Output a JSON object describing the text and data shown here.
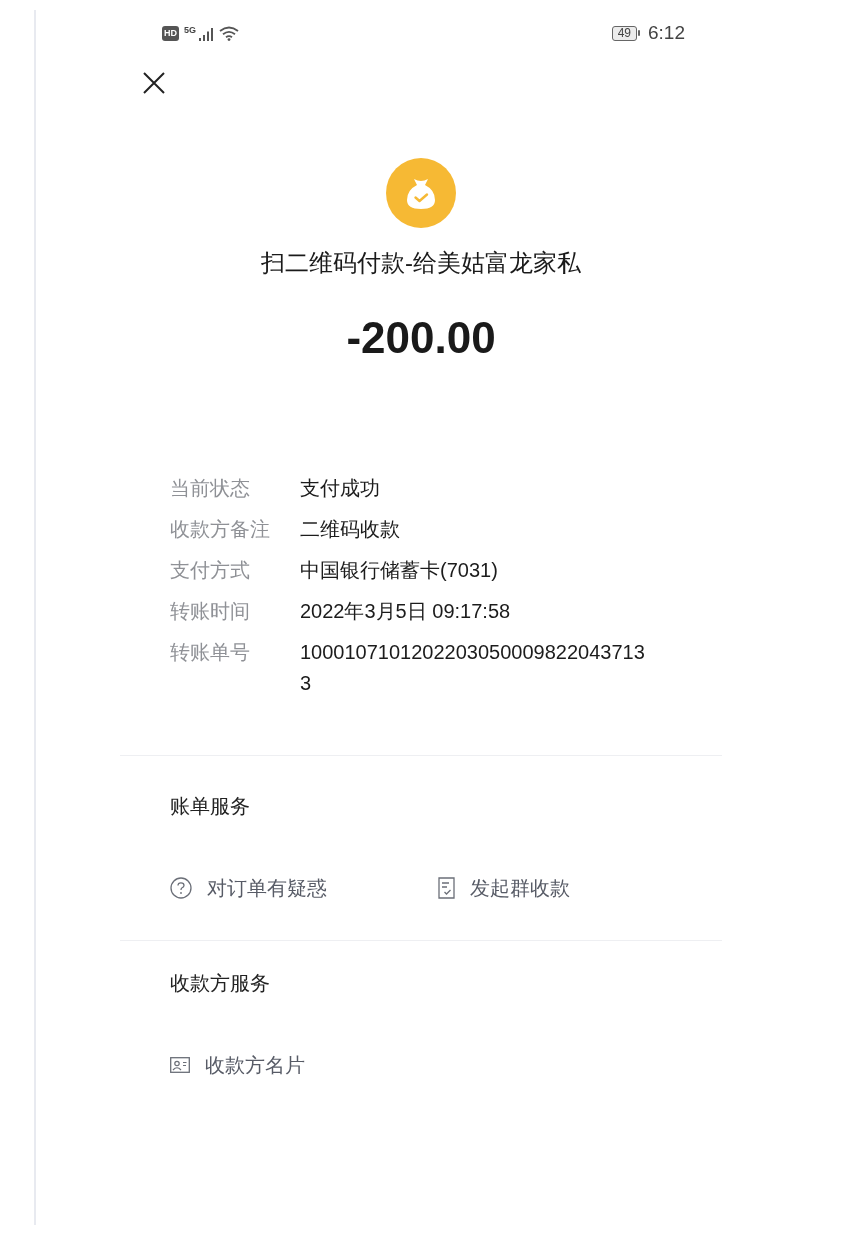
{
  "status_bar": {
    "hd": "HD",
    "network": "5G",
    "battery": "49",
    "time": "6:12"
  },
  "payment": {
    "title": "扫二维码付款-给美姑富龙家私",
    "amount": "-200.00"
  },
  "details": [
    {
      "label": "当前状态",
      "value": "支付成功"
    },
    {
      "label": "收款方备注",
      "value": "二维码收款"
    },
    {
      "label": "支付方式",
      "value": "中国银行储蓄卡(7031)"
    },
    {
      "label": "转账时间",
      "value": "2022年3月5日 09:17:58"
    },
    {
      "label": "转账单号",
      "value": "10001071012022030500098220437133"
    }
  ],
  "sections": [
    {
      "title": "账单服务",
      "actions": [
        {
          "kind": "question",
          "label": "对订单有疑惑"
        },
        {
          "kind": "receipt",
          "label": "发起群收款"
        }
      ]
    },
    {
      "title": "收款方服务",
      "actions": [
        {
          "kind": "card",
          "label": "收款方名片"
        }
      ]
    }
  ]
}
